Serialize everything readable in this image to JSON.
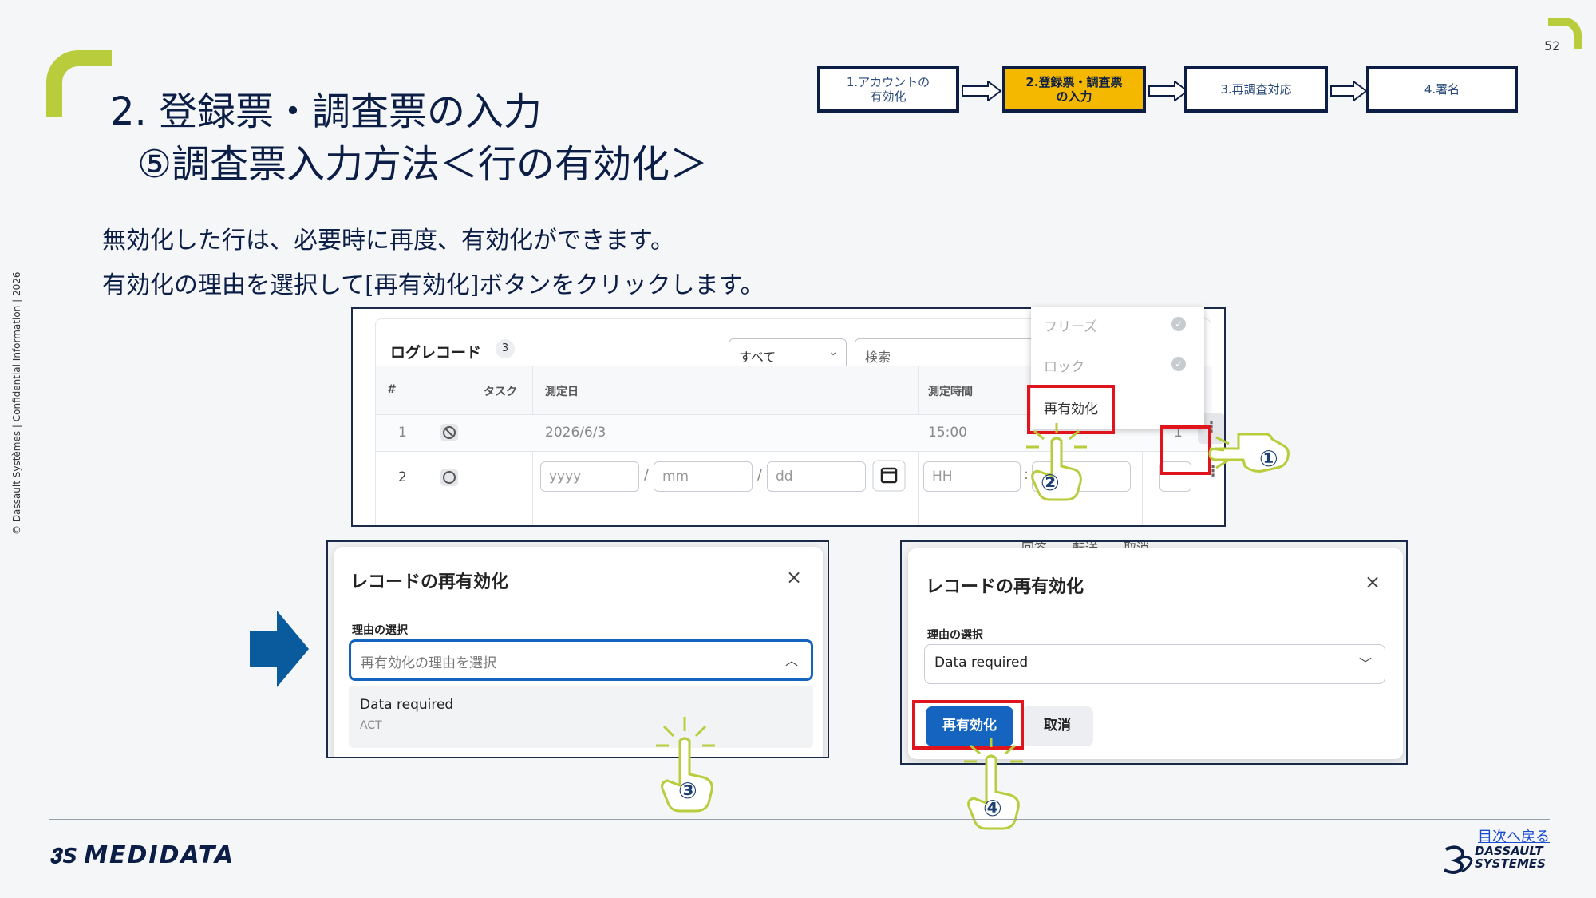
{
  "page": {
    "number": "52",
    "title_line1": "2. 登録票・調査票の入力",
    "title_line2": "⑤調査票入力方法＜行の有効化＞",
    "body_line1": "無効化した行は、必要時に再度、有効化ができます。",
    "body_line2": "有効化の理由を選択して[再有効化]ボタンをクリックします。",
    "copyright": "© Dassault Systèmes | Confidential Information | 2026"
  },
  "steps": [
    {
      "label": "1.アカウントの\n有効化"
    },
    {
      "label": "2.登録票・調査票\nの入力"
    },
    {
      "label": "3.再調査対応"
    },
    {
      "label": "4.署名"
    }
  ],
  "log_record": {
    "title": "ログレコード",
    "count": "3",
    "filter_value": "すべて",
    "search_placeholder": "検索",
    "columns": {
      "num": "#",
      "task": "タスク",
      "date": "測定日",
      "time": "測定時間"
    },
    "row1": {
      "num": "1",
      "date": "2026/6/3",
      "time": "15:00",
      "extra": "1"
    },
    "row2": {
      "num": "2",
      "yyyy": "yyyy",
      "mm": "mm",
      "dd": "dd",
      "hh": "HH",
      "min": "mm",
      "sep": "/",
      "colon": ":"
    }
  },
  "menu": {
    "freeze": "フリーズ",
    "lock": "ロック",
    "reactivate": "再有効化"
  },
  "modal_left": {
    "title": "レコードの再有効化",
    "close": "×",
    "field_label": "理由の選択",
    "placeholder": "再有効化の理由を選択",
    "option_main": "Data required",
    "option_sub": "ACT"
  },
  "modal_right": {
    "title": "レコードの再有効化",
    "close": "×",
    "field_label": "理由の選択",
    "selected_value": "Data required",
    "reactivate_button": "再有効化",
    "cancel_button": "取消",
    "bg_text": "回答　　転送　　取消"
  },
  "callouts": [
    "①",
    "②",
    "③",
    "④"
  ],
  "footer": {
    "medidata_logo": "MEDIDATA",
    "ds_logo_line1": "DASSAULT",
    "ds_logo_line2": "SYSTEMES",
    "toc_link": "目次へ戻る"
  },
  "colors": {
    "accent_green": "#b8cc3c",
    "navy": "#0c1e46",
    "active_step": "#f5b800",
    "highlight_red": "#e0141c",
    "primary_button": "#1565c0"
  }
}
